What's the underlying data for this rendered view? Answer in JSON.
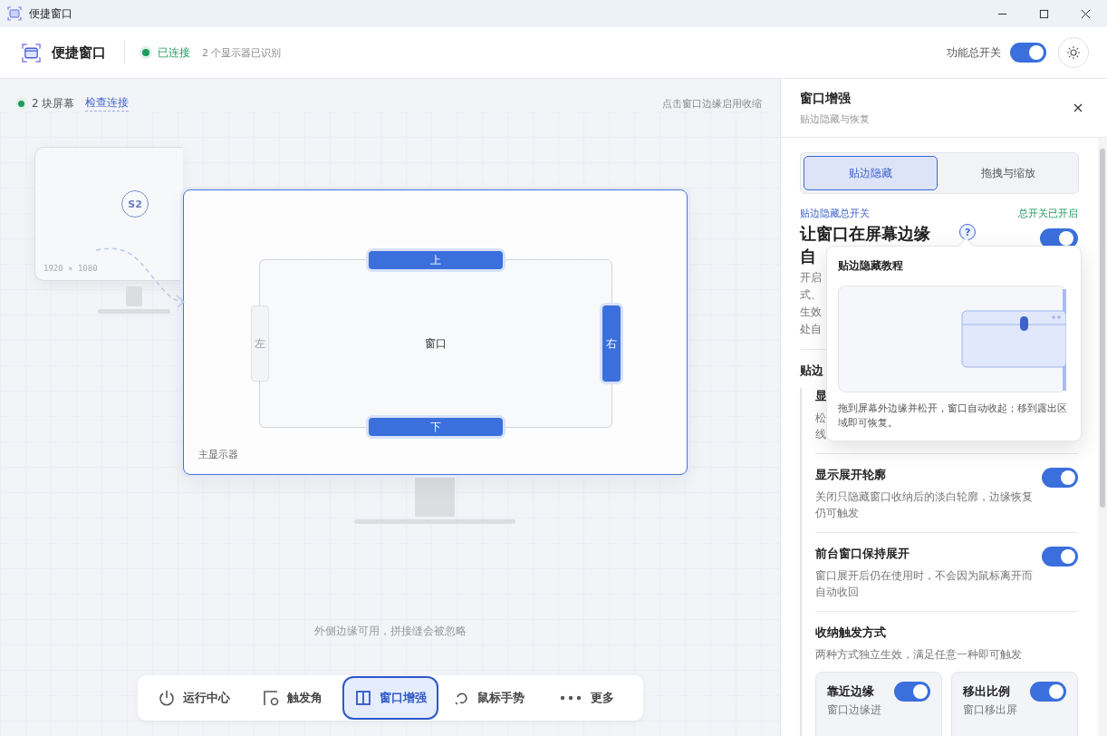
{
  "window": {
    "title": "便捷窗口"
  },
  "header": {
    "app_name": "便捷窗口",
    "status": "已连接",
    "connected": true,
    "detail": "2 个显示器已识别",
    "master_switch": {
      "label": "功能总开关",
      "on": true
    }
  },
  "canvas": {
    "screens_label": "2 块屏幕",
    "check_link": "检查连接",
    "hint_top": "点击窗口边缘启用收缩",
    "secondary": {
      "badge": "S2",
      "resolution": "1920 × 1080"
    },
    "primary": {
      "label": "主显示器",
      "window_label": "窗口",
      "edges": [
        {
          "label": "上",
          "kind": "top",
          "enabled": true
        },
        {
          "label": "下",
          "kind": "bottom",
          "enabled": true
        },
        {
          "label": "右",
          "kind": "right",
          "enabled": true
        },
        {
          "label": "左",
          "kind": "left",
          "enabled": false
        }
      ]
    },
    "hint_bottom": "外侧边缘可用，拼接缝会被忽略"
  },
  "nav": [
    {
      "label": "运行中心",
      "kind": "power",
      "selected": false
    },
    {
      "label": "触发角",
      "kind": "corner",
      "selected": false
    },
    {
      "label": "窗口增强",
      "kind": "columns",
      "selected": true
    },
    {
      "label": "鼠标手势",
      "kind": "gesture",
      "selected": false
    },
    {
      "label": "更多",
      "kind": "more",
      "selected": false
    }
  ],
  "panel": {
    "title": "窗口增强",
    "subtitle": "贴边隐藏与恢复",
    "tabs": [
      {
        "label": "贴边隐藏",
        "selected": true
      },
      {
        "label": "拖拽与缩放",
        "selected": false
      }
    ],
    "master": {
      "label": "贴边隐藏总开关",
      "status": "总开关已开启",
      "title_lines": [
        "让窗口在屏幕边缘",
        "自"
      ],
      "help": "?",
      "on": true,
      "description_lines": [
        "开启",
        "式、",
        "生效",
        "处自"
      ]
    },
    "section_heading": "贴边",
    "covered_item": {
      "title": "显",
      "description_lines": [
        "松",
        "线"
      ]
    },
    "settings": [
      {
        "title": "显示展开轮廓",
        "description": "关闭只隐藏窗口收纳后的淡白轮廓，边缘恢复仍可触发",
        "on": true
      },
      {
        "title": "前台窗口保持展开",
        "description": "窗口展开后仍在使用时，不会因为鼠标离开而自动收回",
        "on": true
      }
    ],
    "trigger": {
      "title": "收纳触发方式",
      "description": "两种方式独立生效，满足任意一种即可触发",
      "options": [
        {
          "title": "靠近边缘",
          "description": "窗口边缘进",
          "on": true
        },
        {
          "title": "移出比例",
          "description": "窗口移出屏",
          "on": true
        }
      ]
    },
    "popover": {
      "title": "贴边隐藏教程",
      "text": "拖到屏幕外边缘并松开，窗口自动收起；移到露出区域即可恢复。"
    }
  }
}
